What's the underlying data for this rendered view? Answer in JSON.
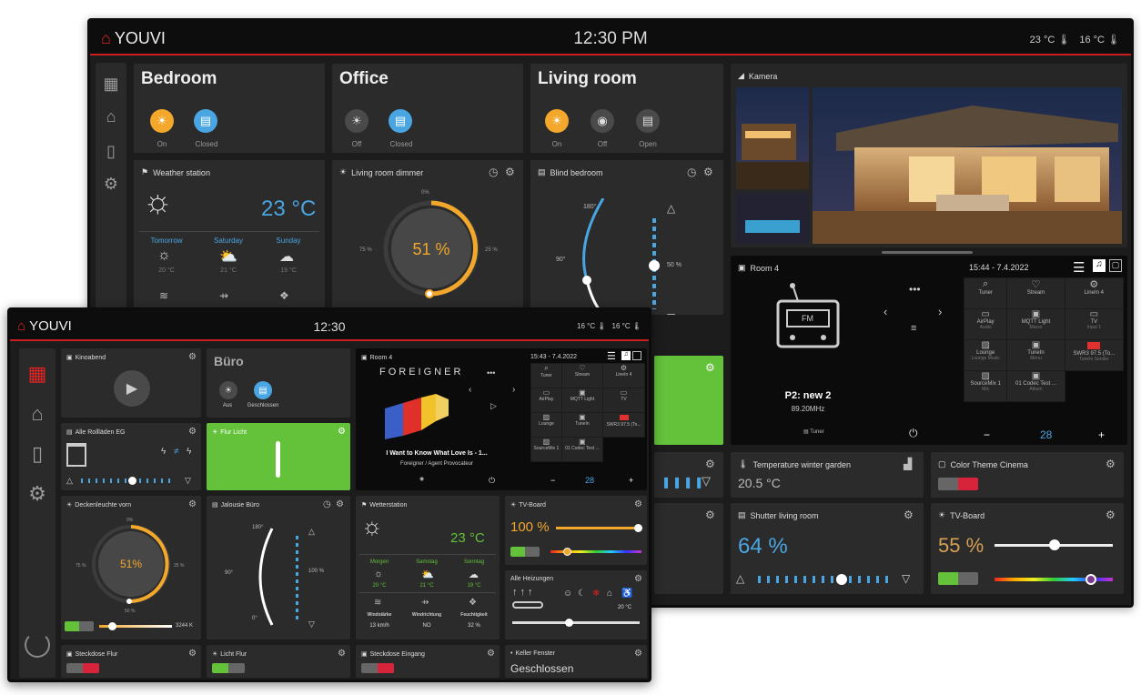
{
  "back": {
    "brand": "YOUVI",
    "time": "12:30 PM",
    "temp1": "23 °C",
    "temp2": "16 °C",
    "rooms": [
      {
        "title": "Bedroom",
        "s1": "On",
        "s2": "Closed"
      },
      {
        "title": "Office",
        "s1": "Off",
        "s2": "Closed"
      },
      {
        "title": "Living room",
        "s1": "On",
        "s2": "Off",
        "s3": "Open"
      }
    ],
    "camera": {
      "title": "Kamera"
    },
    "weather": {
      "title": "Weather station",
      "temp": "23 °C",
      "days": [
        "Tomorrow",
        "Saturday",
        "Sunday"
      ],
      "temps": [
        "20 °C",
        "21 °C",
        "19 °C"
      ]
    },
    "dimmer": {
      "title": "Living room dimmer",
      "value": "51 %",
      "t0": "0%",
      "t25": "25 %",
      "t75": "75 %"
    },
    "blind": {
      "title": "Blind bedroom",
      "a1": "180°",
      "a2": "90°",
      "pct": "50 %"
    },
    "radio": {
      "room": "Room 4",
      "datetime": "15:44 - 7.4.2022",
      "station": "P2: new 2",
      "freq": "89.20MHz",
      "fm": "FM",
      "tuner": "Tuner",
      "vol": "28",
      "minus": "−",
      "plus": "+",
      "grid": [
        [
          "Tuner",
          "Stream",
          "LineIn 4"
        ],
        [
          "AirPlay",
          "MQTT Light",
          "TV"
        ],
        [
          "Lounge",
          "TuneIn",
          "SWR3 97.5 (To..."
        ],
        [
          "SourceMix 1",
          "01 Codec Test ...",
          ""
        ]
      ],
      "gridsub": [
        [
          "",
          "",
          ""
        ],
        [
          "Audio",
          "Macro",
          "Input 1"
        ],
        [
          "Lounge Music",
          "Menu",
          "TuneIn Sender"
        ],
        [
          "Mix",
          "Album",
          ""
        ]
      ]
    },
    "tempGarden": {
      "title": "Temperature winter garden",
      "value": "20.5 °C"
    },
    "colorTheme": {
      "title": "Color Theme Cinema"
    },
    "shutter": {
      "title": "Shutter living room",
      "value": "64 %"
    },
    "tvboard": {
      "title": "TV-Board",
      "value": "55 %"
    }
  },
  "front": {
    "brand": "YOUVI",
    "time": "12:30",
    "temp1": "16 °C",
    "temp2": "16 °C",
    "kino": {
      "title": "Kinoabend"
    },
    "buero": {
      "title": "Büro",
      "s1": "Aus",
      "s2": "Geschlossen"
    },
    "rollladen": {
      "title": "Alle Rollläden EG"
    },
    "flur": {
      "title": "Flur Licht"
    },
    "room4": {
      "title": "Room 4",
      "datetime": "15:43 - 7.4.2022",
      "band": "FOREIGNER",
      "track": "I Want to Know What Love Is - 1...",
      "artist": "Foreigner / Agent Provocateur",
      "vol": "28",
      "minus": "−",
      "plus": "+",
      "grid": [
        [
          "Tuner",
          "Stream",
          "LineIn 4"
        ],
        [
          "AirPlay",
          "MQTT Light",
          "TV"
        ],
        [
          "Lounge",
          "TuneIn",
          "SWR3 97.5 (To..."
        ],
        [
          "SourceMix 1",
          "01 Codec Test ...",
          ""
        ]
      ]
    },
    "decke": {
      "title": "Deckenleuchte vorn",
      "value": "51%",
      "t0": "0%",
      "t25": "25 %",
      "t75": "75 %",
      "t50": "50 %",
      "kelvin": "3244 K"
    },
    "jalousie": {
      "title": "Jalousie Büro",
      "a1": "180°",
      "a2": "90°",
      "a3": "0°",
      "pct": "100 %"
    },
    "wetter": {
      "title": "Wetterstation",
      "temp": "23 °C",
      "days": [
        "Morgen",
        "Samstag",
        "Sonntag"
      ],
      "temps": [
        "20 °C",
        "21 °C",
        "19 °C"
      ],
      "labels": [
        "Windstärke",
        "Windrichtung",
        "Feuchtigkeit"
      ],
      "values": [
        "13 km/h",
        "NO",
        "32 %"
      ]
    },
    "tvboard": {
      "title": "TV-Board",
      "value": "100 %"
    },
    "heizung": {
      "title": "Alle Heizungen",
      "temp": "20 °C"
    },
    "steckdoseFlur": {
      "title": "Steckdose Flur"
    },
    "lichtFlur": {
      "title": "Licht Flur"
    },
    "steckdoseEingang": {
      "title": "Steckdose Eingang"
    },
    "keller": {
      "title": "Keller Fenster",
      "value": "Geschlossen"
    }
  }
}
